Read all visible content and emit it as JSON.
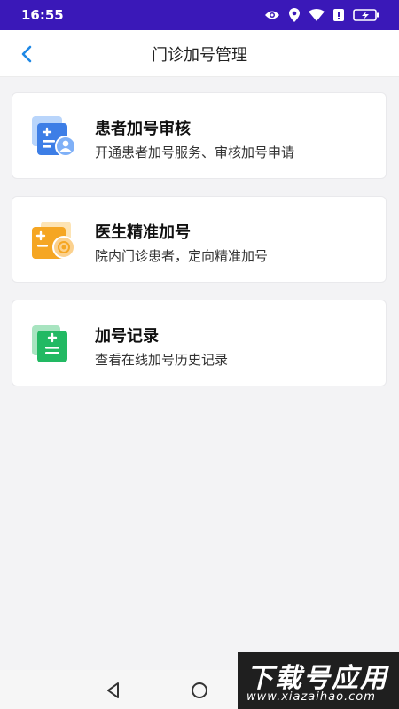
{
  "status": {
    "time": "16:55"
  },
  "header": {
    "title": "门诊加号管理"
  },
  "cards": [
    {
      "title": "患者加号审核",
      "subtitle": "开通患者加号服务、审核加号申请",
      "icon": "patient-review-icon"
    },
    {
      "title": "医生精准加号",
      "subtitle": "院内门诊患者，定向精准加号",
      "icon": "doctor-precise-icon"
    },
    {
      "title": "加号记录",
      "subtitle": "查看在线加号历史记录",
      "icon": "records-icon"
    }
  ],
  "watermark": {
    "main": "下载号应用",
    "url": "www.xiazaihao.com"
  },
  "colors": {
    "status_bar": "#3a18b8",
    "accent": "#1e88e5"
  }
}
